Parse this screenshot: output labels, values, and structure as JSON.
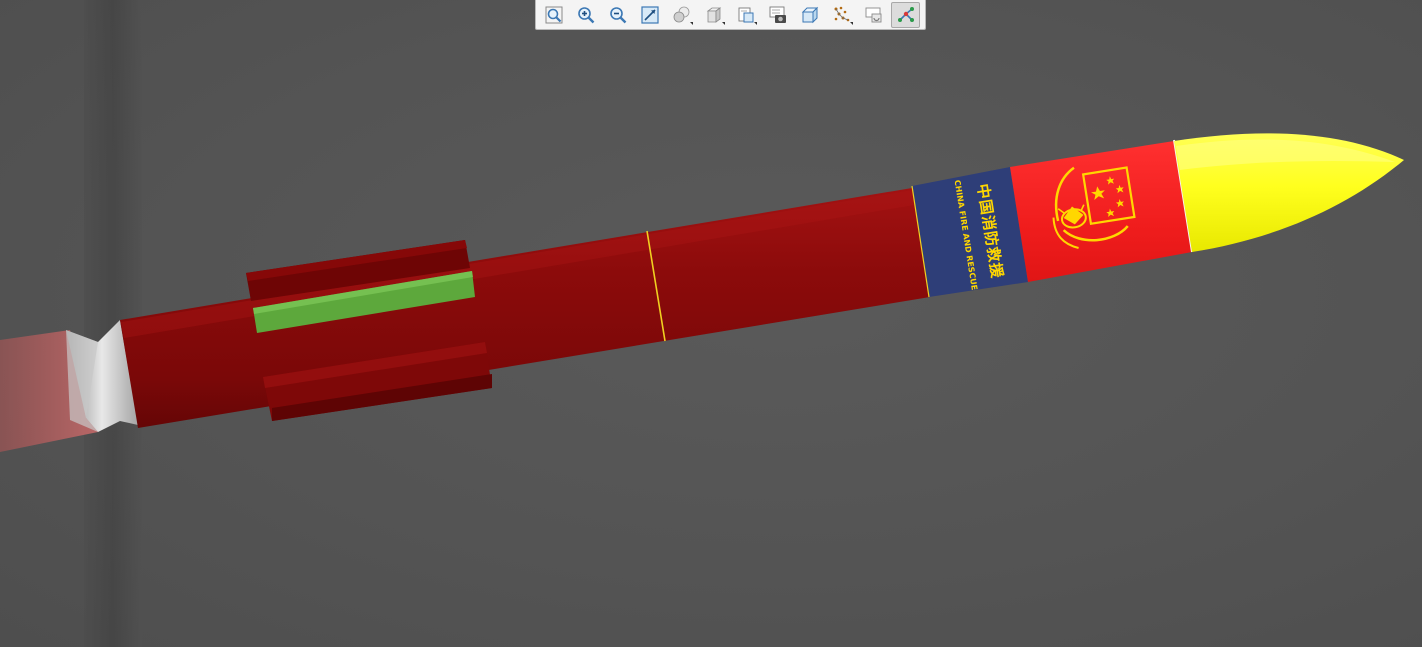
{
  "toolbar": {
    "tools": [
      {
        "id": "zoom-to-fit",
        "icon": "zoom-fit-icon"
      },
      {
        "id": "zoom-in",
        "icon": "zoom-in-icon"
      },
      {
        "id": "zoom-out",
        "icon": "zoom-out-icon"
      },
      {
        "id": "zoom-to-area",
        "icon": "zoom-area-icon"
      },
      {
        "id": "shading-mode",
        "icon": "shading-spheres-icon",
        "dropdown": true
      },
      {
        "id": "view-cube",
        "icon": "cube-view-icon",
        "dropdown": true
      },
      {
        "id": "section-view",
        "icon": "section-view-icon",
        "dropdown": true
      },
      {
        "id": "screenshot",
        "icon": "camera-icon"
      },
      {
        "id": "bounding-box",
        "icon": "wireframe-box-icon"
      },
      {
        "id": "points-display",
        "icon": "scatter-points-icon",
        "dropdown": true
      },
      {
        "id": "display-settings",
        "icon": "display-settings-icon"
      },
      {
        "id": "path-mode",
        "icon": "path-nodes-icon",
        "active": true
      }
    ]
  },
  "colors": {
    "viewport_bg": "#555555",
    "body_red": "#8b0a0a",
    "band_blue": "#2e3e78",
    "band_red": "#f02020",
    "nose_yellow": "#ffff1a",
    "window_green": "#5da83c",
    "seam_yellow": "#f0d020",
    "emblem_yellow": "#ffd700"
  },
  "rocket": {
    "band_text_cn": "中国消防救援",
    "band_text_en": "CHINA FIRE AND RESCUE"
  }
}
